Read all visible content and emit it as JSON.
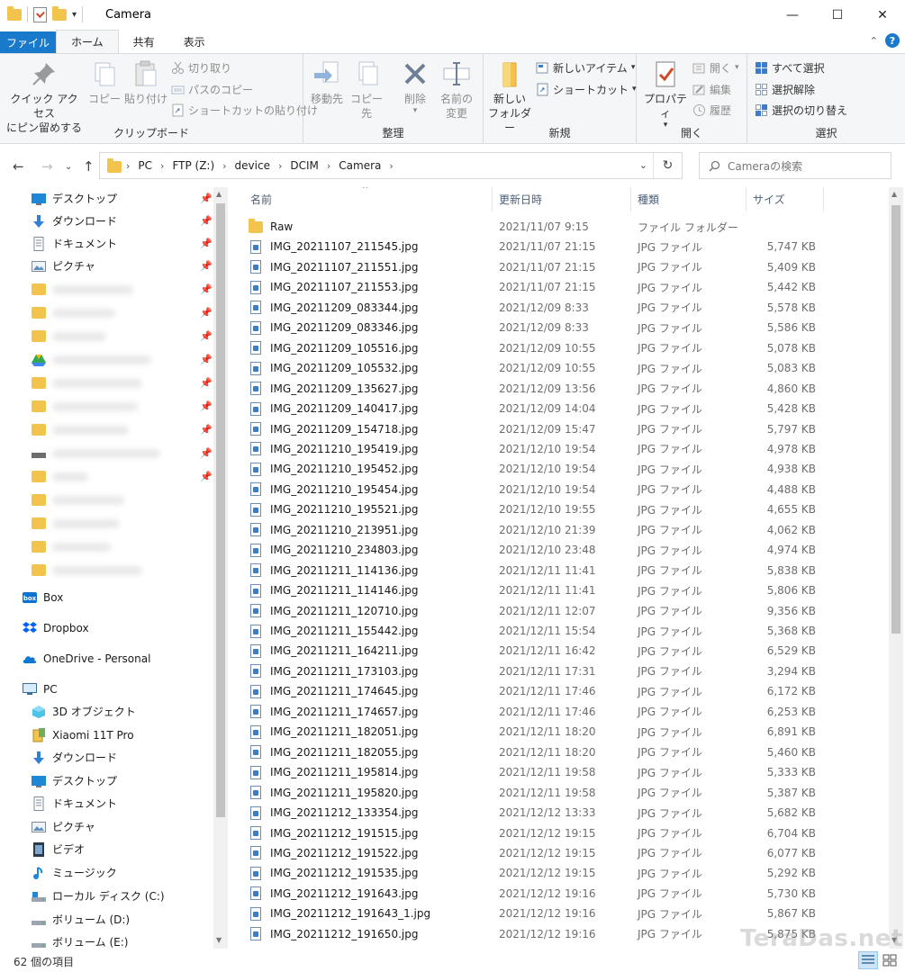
{
  "window": {
    "title": "Camera"
  },
  "tabs": [
    {
      "label": "ファイル"
    },
    {
      "label": "ホーム"
    },
    {
      "label": "共有"
    },
    {
      "label": "表示"
    }
  ],
  "ribbon": {
    "clipboard": {
      "label": "クリップボード",
      "pin_quick_line1": "クイック アクセス",
      "pin_quick_line2": "にピン留めする",
      "copy": "コピー",
      "paste": "貼り付け",
      "cut": "切り取り",
      "copy_path": "パスのコピー",
      "paste_shortcut": "ショートカットの貼り付け"
    },
    "organize": {
      "label": "整理",
      "move_to": "移動先",
      "copy_to": "コピー先",
      "delete": "削除",
      "rename_line1": "名前の",
      "rename_line2": "変更"
    },
    "new": {
      "label": "新規",
      "new_folder_line1": "新しい",
      "new_folder_line2": "フォルダー",
      "new_item": "新しいアイテム",
      "shortcut": "ショートカット"
    },
    "open": {
      "label": "開く",
      "properties": "プロパティ",
      "open": "開く",
      "edit": "編集",
      "history": "履歴"
    },
    "select": {
      "label": "選択",
      "select_all": "すべて選択",
      "select_none": "選択解除",
      "invert": "選択の切り替え"
    }
  },
  "address": {
    "crumbs": [
      "PC",
      "FTP (Z:)",
      "device",
      "DCIM",
      "Camera"
    ]
  },
  "search": {
    "placeholder": "Cameraの検索"
  },
  "nav": {
    "quick_access": [
      {
        "label": "デスクトップ",
        "icon": "desktop-icon"
      },
      {
        "label": "ダウンロード",
        "icon": "download-icon"
      },
      {
        "label": "ドキュメント",
        "icon": "document-icon"
      },
      {
        "label": "ピクチャ",
        "icon": "pictures-icon"
      }
    ],
    "cloud": [
      {
        "label": "Box",
        "icon": "box-icon"
      },
      {
        "label": "Dropbox",
        "icon": "dropbox-icon"
      },
      {
        "label": "OneDrive - Personal",
        "icon": "onedrive-icon"
      }
    ],
    "pc_label": "PC",
    "pc_items": [
      {
        "label": "3D オブジェクト",
        "icon": "3d-objects-icon"
      },
      {
        "label": "Xiaomi 11T Pro",
        "icon": "phone-icon"
      },
      {
        "label": "ダウンロード",
        "icon": "download-icon"
      },
      {
        "label": "デスクトップ",
        "icon": "desktop-icon"
      },
      {
        "label": "ドキュメント",
        "icon": "document-icon"
      },
      {
        "label": "ピクチャ",
        "icon": "pictures-icon"
      },
      {
        "label": "ビデオ",
        "icon": "video-icon"
      },
      {
        "label": "ミュージック",
        "icon": "music-icon"
      },
      {
        "label": "ローカル ディスク (C:)",
        "icon": "disk-icon"
      },
      {
        "label": "ボリューム (D:)",
        "icon": "disk-icon"
      },
      {
        "label": "ボリューム (E:)",
        "icon": "disk-icon"
      }
    ]
  },
  "columns": {
    "name": "名前",
    "date": "更新日時",
    "type": "種類",
    "size": "サイズ"
  },
  "files": [
    {
      "name": "Raw",
      "date": "2021/11/07 9:15",
      "type": "ファイル フォルダー",
      "size": "",
      "kind": "folder"
    },
    {
      "name": "IMG_20211107_211545.jpg",
      "date": "2021/11/07 21:15",
      "type": "JPG ファイル",
      "size": "5,747 KB",
      "kind": "file"
    },
    {
      "name": "IMG_20211107_211551.jpg",
      "date": "2021/11/07 21:15",
      "type": "JPG ファイル",
      "size": "5,409 KB",
      "kind": "file"
    },
    {
      "name": "IMG_20211107_211553.jpg",
      "date": "2021/11/07 21:15",
      "type": "JPG ファイル",
      "size": "5,442 KB",
      "kind": "file"
    },
    {
      "name": "IMG_20211209_083344.jpg",
      "date": "2021/12/09 8:33",
      "type": "JPG ファイル",
      "size": "5,578 KB",
      "kind": "file"
    },
    {
      "name": "IMG_20211209_083346.jpg",
      "date": "2021/12/09 8:33",
      "type": "JPG ファイル",
      "size": "5,586 KB",
      "kind": "file"
    },
    {
      "name": "IMG_20211209_105516.jpg",
      "date": "2021/12/09 10:55",
      "type": "JPG ファイル",
      "size": "5,078 KB",
      "kind": "file"
    },
    {
      "name": "IMG_20211209_105532.jpg",
      "date": "2021/12/09 10:55",
      "type": "JPG ファイル",
      "size": "5,083 KB",
      "kind": "file"
    },
    {
      "name": "IMG_20211209_135627.jpg",
      "date": "2021/12/09 13:56",
      "type": "JPG ファイル",
      "size": "4,860 KB",
      "kind": "file"
    },
    {
      "name": "IMG_20211209_140417.jpg",
      "date": "2021/12/09 14:04",
      "type": "JPG ファイル",
      "size": "5,428 KB",
      "kind": "file"
    },
    {
      "name": "IMG_20211209_154718.jpg",
      "date": "2021/12/09 15:47",
      "type": "JPG ファイル",
      "size": "5,797 KB",
      "kind": "file"
    },
    {
      "name": "IMG_20211210_195419.jpg",
      "date": "2021/12/10 19:54",
      "type": "JPG ファイル",
      "size": "4,978 KB",
      "kind": "file"
    },
    {
      "name": "IMG_20211210_195452.jpg",
      "date": "2021/12/10 19:54",
      "type": "JPG ファイル",
      "size": "4,938 KB",
      "kind": "file"
    },
    {
      "name": "IMG_20211210_195454.jpg",
      "date": "2021/12/10 19:54",
      "type": "JPG ファイル",
      "size": "4,488 KB",
      "kind": "file"
    },
    {
      "name": "IMG_20211210_195521.jpg",
      "date": "2021/12/10 19:55",
      "type": "JPG ファイル",
      "size": "4,655 KB",
      "kind": "file"
    },
    {
      "name": "IMG_20211210_213951.jpg",
      "date": "2021/12/10 21:39",
      "type": "JPG ファイル",
      "size": "4,062 KB",
      "kind": "file"
    },
    {
      "name": "IMG_20211210_234803.jpg",
      "date": "2021/12/10 23:48",
      "type": "JPG ファイル",
      "size": "4,974 KB",
      "kind": "file"
    },
    {
      "name": "IMG_20211211_114136.jpg",
      "date": "2021/12/11 11:41",
      "type": "JPG ファイル",
      "size": "5,838 KB",
      "kind": "file"
    },
    {
      "name": "IMG_20211211_114146.jpg",
      "date": "2021/12/11 11:41",
      "type": "JPG ファイル",
      "size": "5,806 KB",
      "kind": "file"
    },
    {
      "name": "IMG_20211211_120710.jpg",
      "date": "2021/12/11 12:07",
      "type": "JPG ファイル",
      "size": "9,356 KB",
      "kind": "file"
    },
    {
      "name": "IMG_20211211_155442.jpg",
      "date": "2021/12/11 15:54",
      "type": "JPG ファイル",
      "size": "5,368 KB",
      "kind": "file"
    },
    {
      "name": "IMG_20211211_164211.jpg",
      "date": "2021/12/11 16:42",
      "type": "JPG ファイル",
      "size": "6,529 KB",
      "kind": "file"
    },
    {
      "name": "IMG_20211211_173103.jpg",
      "date": "2021/12/11 17:31",
      "type": "JPG ファイル",
      "size": "3,294 KB",
      "kind": "file"
    },
    {
      "name": "IMG_20211211_174645.jpg",
      "date": "2021/12/11 17:46",
      "type": "JPG ファイル",
      "size": "6,172 KB",
      "kind": "file"
    },
    {
      "name": "IMG_20211211_174657.jpg",
      "date": "2021/12/11 17:46",
      "type": "JPG ファイル",
      "size": "6,253 KB",
      "kind": "file"
    },
    {
      "name": "IMG_20211211_182051.jpg",
      "date": "2021/12/11 18:20",
      "type": "JPG ファイル",
      "size": "6,891 KB",
      "kind": "file"
    },
    {
      "name": "IMG_20211211_182055.jpg",
      "date": "2021/12/11 18:20",
      "type": "JPG ファイル",
      "size": "5,460 KB",
      "kind": "file"
    },
    {
      "name": "IMG_20211211_195814.jpg",
      "date": "2021/12/11 19:58",
      "type": "JPG ファイル",
      "size": "5,333 KB",
      "kind": "file"
    },
    {
      "name": "IMG_20211211_195820.jpg",
      "date": "2021/12/11 19:58",
      "type": "JPG ファイル",
      "size": "5,387 KB",
      "kind": "file"
    },
    {
      "name": "IMG_20211212_133354.jpg",
      "date": "2021/12/12 13:33",
      "type": "JPG ファイル",
      "size": "5,682 KB",
      "kind": "file"
    },
    {
      "name": "IMG_20211212_191515.jpg",
      "date": "2021/12/12 19:15",
      "type": "JPG ファイル",
      "size": "6,704 KB",
      "kind": "file"
    },
    {
      "name": "IMG_20211212_191522.jpg",
      "date": "2021/12/12 19:15",
      "type": "JPG ファイル",
      "size": "6,077 KB",
      "kind": "file"
    },
    {
      "name": "IMG_20211212_191535.jpg",
      "date": "2021/12/12 19:15",
      "type": "JPG ファイル",
      "size": "5,292 KB",
      "kind": "file"
    },
    {
      "name": "IMG_20211212_191643.jpg",
      "date": "2021/12/12 19:16",
      "type": "JPG ファイル",
      "size": "5,730 KB",
      "kind": "file"
    },
    {
      "name": "IMG_20211212_191643_1.jpg",
      "date": "2021/12/12 19:16",
      "type": "JPG ファイル",
      "size": "5,867 KB",
      "kind": "file"
    },
    {
      "name": "IMG_20211212_191650.jpg",
      "date": "2021/12/12 19:16",
      "type": "JPG ファイル",
      "size": "5,875 KB",
      "kind": "file"
    }
  ],
  "status": {
    "item_count": "62 個の項目"
  },
  "watermark": "TeraDas.net",
  "colors": {
    "accent": "#1979ca",
    "folder": "#f2c44e"
  }
}
